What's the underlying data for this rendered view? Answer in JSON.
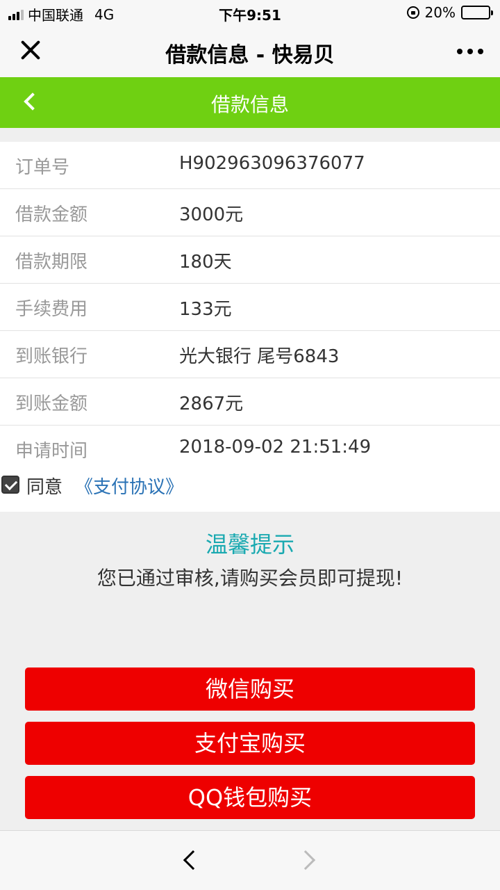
{
  "status_bar": {
    "carrier": "中国联通",
    "network": "4G",
    "time": "下午9:51",
    "battery": "20%"
  },
  "wechat_header": {
    "title": "借款信息 - 快易贝"
  },
  "page_nav": {
    "title": "借款信息"
  },
  "info": [
    {
      "label": "订单号",
      "value": "H902963096376077"
    },
    {
      "label": "借款金额",
      "value": "3000元"
    },
    {
      "label": "借款期限",
      "value": "180天"
    },
    {
      "label": "手续费用",
      "value": "133元"
    },
    {
      "label": "到账银行",
      "value": "光大银行 尾号6843"
    },
    {
      "label": "到账金额",
      "value": "2867元"
    },
    {
      "label": "申请时间",
      "value": "2018-09-02 21:51:49"
    }
  ],
  "agreement": {
    "checked": true,
    "text": "同意",
    "link": "《支付协议》"
  },
  "tip": {
    "title": "温馨提示",
    "text": "您已通过审核,请购买会员即可提现!"
  },
  "buttons": {
    "wechat": "微信购买",
    "alipay": "支付宝购买",
    "qq": "QQ钱包购买"
  },
  "colors": {
    "nav_green": "#6fd012",
    "button_red": "#ee0000",
    "tip_teal": "#19a9b0",
    "link_blue": "#2a72b5"
  }
}
